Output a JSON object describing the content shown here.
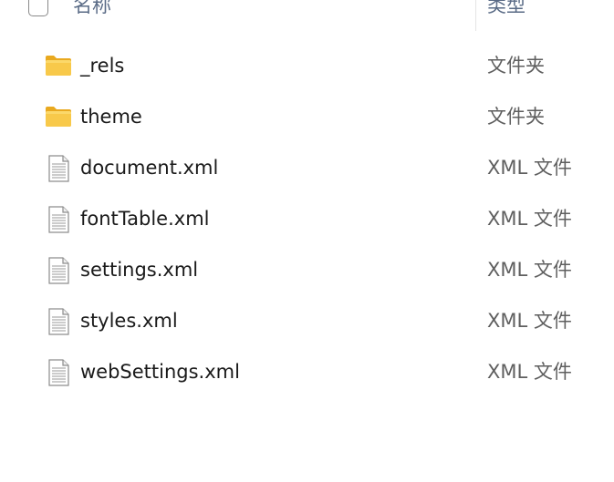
{
  "header": {
    "name_label": "名称",
    "type_label": "类型"
  },
  "files": [
    {
      "name": "_rels",
      "type": "文件夹",
      "icon": "folder-icon"
    },
    {
      "name": "theme",
      "type": "文件夹",
      "icon": "folder-icon"
    },
    {
      "name": "document.xml",
      "type": "XML 文件",
      "icon": "document-icon"
    },
    {
      "name": "fontTable.xml",
      "type": "XML 文件",
      "icon": "document-icon"
    },
    {
      "name": "settings.xml",
      "type": "XML 文件",
      "icon": "document-icon"
    },
    {
      "name": "styles.xml",
      "type": "XML 文件",
      "icon": "document-icon"
    },
    {
      "name": "webSettings.xml",
      "type": "XML 文件",
      "icon": "document-icon"
    }
  ],
  "colors": {
    "folder": "#f8c23a",
    "header_text": "#5a6b86",
    "type_text": "#5f5f5f"
  }
}
